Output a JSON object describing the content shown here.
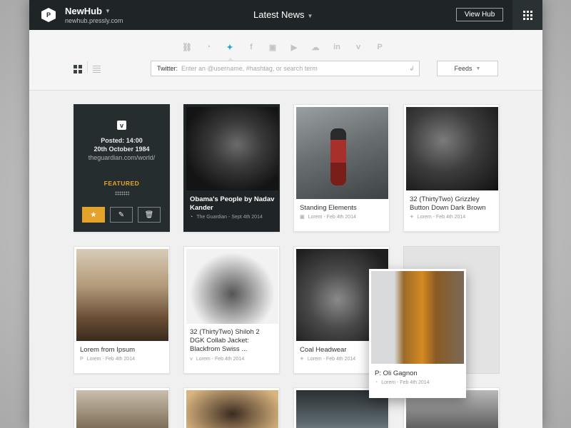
{
  "header": {
    "logo_letter": "P",
    "hub_name": "NewHub",
    "hub_url": "newhub.pressly.com",
    "title": "Latest News",
    "view_hub_label": "View Hub"
  },
  "toolbar": {
    "networks": [
      "link",
      "rss",
      "twitter",
      "facebook",
      "instagram",
      "youtube",
      "soundcloud",
      "linkedin",
      "vimeo",
      "pinterest"
    ],
    "active_network": "twitter",
    "search_label": "Twitter:",
    "search_placeholder": "Enter an @username, #hashtag, or search term",
    "feeds_label": "Feeds"
  },
  "featured_card": {
    "posted": "Posted: 14:00",
    "date": "20th October 1984",
    "url": "theguardian.com/world/",
    "tag": "FEATURED"
  },
  "cards": [
    {
      "title": "Obama's People by Nadav Kander",
      "source": "The Guardian - Sept 4th 2014",
      "icon": "rss"
    },
    {
      "title": "Standing Elements",
      "source": "Lorem - Feb 4th 2014",
      "icon": "instagram"
    },
    {
      "title": "32 (ThirtyTwo) Grizzley Button Down Dark Brown",
      "source": "Lorem - Feb 4th 2014",
      "icon": "twitter"
    },
    {
      "title": "Lorem from Ipsum",
      "source": "Lorem - Feb 4th 2014",
      "icon": "pinterest"
    },
    {
      "title": "32 (ThirtyTwo) Shiloh 2 DGK Collab Jacket: Blackfrom Swiss ...",
      "source": "Lorem - Feb 4th 2014",
      "icon": "vimeo"
    },
    {
      "title": "Coal Headwear",
      "source": "Lorem - Feb 4th 2014",
      "icon": "twitter"
    }
  ],
  "dragging_card": {
    "title": "P: Oli Gagnon",
    "source": "Lorem - Feb 4th 2014",
    "icon": "rss"
  },
  "colors": {
    "topbar": "#1f2527",
    "accent": "#27a4d6",
    "featured": "#e3a229"
  }
}
